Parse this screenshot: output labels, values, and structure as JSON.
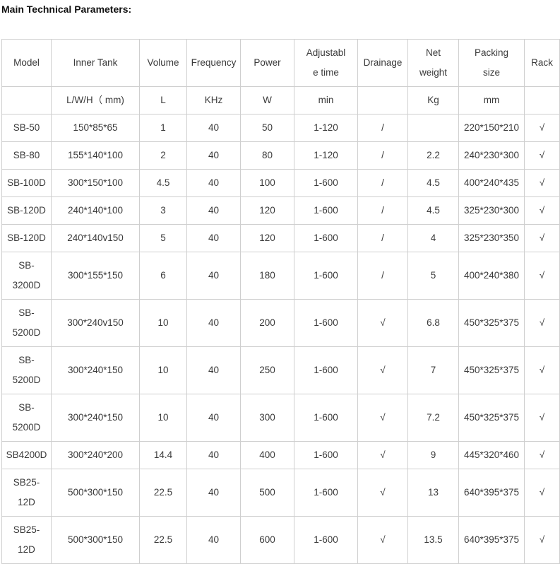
{
  "title": "Main Technical Parameters:",
  "header": {
    "model": "Model",
    "inner_tank": "Inner Tank",
    "volume": "Volume",
    "frequency": "Frequency",
    "power": "Power",
    "adjustable_time": "Adjustable time",
    "drainage": "Drainage",
    "net_weight": "Net weight",
    "packing_size": "Packing size",
    "rack": "Rack"
  },
  "units": {
    "model": "",
    "inner_tank": "L/W/H（ mm)",
    "volume": "L",
    "frequency": "KHz",
    "power": "W",
    "adjustable_time": "min",
    "drainage": "",
    "net_weight": "Kg",
    "packing_size": "mm",
    "rack": ""
  },
  "rows": [
    {
      "model": "SB-50",
      "inner_tank": "150*85*65",
      "volume": "1",
      "frequency": "40",
      "power": "50",
      "time": "1-120",
      "drainage": "/",
      "weight": "",
      "packing": "220*150*210",
      "rack": "√"
    },
    {
      "model": "SB-80",
      "inner_tank": "155*140*100",
      "volume": "2",
      "frequency": "40",
      "power": "80",
      "time": "1-120",
      "drainage": "/",
      "weight": "2.2",
      "packing": "240*230*300",
      "rack": "√"
    },
    {
      "model": "SB-100D",
      "inner_tank": "300*150*100",
      "volume": "4.5",
      "frequency": "40",
      "power": "100",
      "time": "1-600",
      "drainage": "/",
      "weight": "4.5",
      "packing": "400*240*435",
      "rack": "√"
    },
    {
      "model": "SB-120D",
      "inner_tank": "240*140*100",
      "volume": "3",
      "frequency": "40",
      "power": "120",
      "time": "1-600",
      "drainage": "/",
      "weight": "4.5",
      "packing": "325*230*300",
      "rack": "√"
    },
    {
      "model": "SB-120D",
      "inner_tank": "240*140v150",
      "volume": "5",
      "frequency": "40",
      "power": "120",
      "time": "1-600",
      "drainage": "/",
      "weight": "4",
      "packing": "325*230*350",
      "rack": "√"
    },
    {
      "model": "SB-3200D",
      "inner_tank": "300*155*150",
      "volume": "6",
      "frequency": "40",
      "power": "180",
      "time": "1-600",
      "drainage": "/",
      "weight": "5",
      "packing": "400*240*380",
      "rack": "√"
    },
    {
      "model": "SB-5200D",
      "inner_tank": "300*240v150",
      "volume": "10",
      "frequency": "40",
      "power": "200",
      "time": "1-600",
      "drainage": "√",
      "weight": "6.8",
      "packing": "450*325*375",
      "rack": "√"
    },
    {
      "model": "SB-5200D",
      "inner_tank": "300*240*150",
      "volume": "10",
      "frequency": "40",
      "power": "250",
      "time": "1-600",
      "drainage": "√",
      "weight": "7",
      "packing": "450*325*375",
      "rack": "√"
    },
    {
      "model": "SB-5200D",
      "inner_tank": "300*240*150",
      "volume": "10",
      "frequency": "40",
      "power": "300",
      "time": "1-600",
      "drainage": "√",
      "weight": "7.2",
      "packing": "450*325*375",
      "rack": "√"
    },
    {
      "model": "SB4200D",
      "inner_tank": "300*240*200",
      "volume": "14.4",
      "frequency": "40",
      "power": "400",
      "time": "1-600",
      "drainage": "√",
      "weight": "9",
      "packing": "445*320*460",
      "rack": "√"
    },
    {
      "model": "SB25-12D",
      "inner_tank": "500*300*150",
      "volume": "22.5",
      "frequency": "40",
      "power": "500",
      "time": "1-600",
      "drainage": "√",
      "weight": "13",
      "packing": "640*395*375",
      "rack": "√"
    },
    {
      "model": "SB25-12D",
      "inner_tank": "500*300*150",
      "volume": "22.5",
      "frequency": "40",
      "power": "600",
      "time": "1-600",
      "drainage": "√",
      "weight": "13.5",
      "packing": "640*395*375",
      "rack": "√"
    }
  ]
}
